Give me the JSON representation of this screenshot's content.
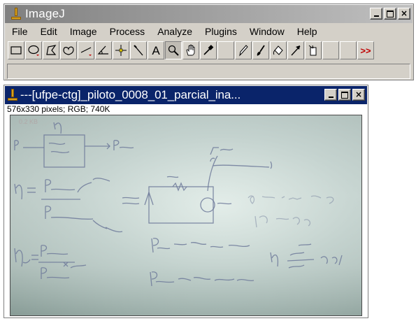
{
  "main_window": {
    "title": "ImageJ",
    "menu": [
      "File",
      "Edit",
      "Image",
      "Process",
      "Analyze",
      "Plugins",
      "Window",
      "Help"
    ],
    "tools": [
      {
        "name": "rectangle-tool",
        "icon": "rectangle-icon"
      },
      {
        "name": "oval-tool",
        "icon": "oval-icon"
      },
      {
        "name": "polygon-tool",
        "icon": "polygon-icon"
      },
      {
        "name": "freehand-tool",
        "icon": "freehand-icon"
      },
      {
        "name": "line-tool",
        "icon": "line-icon"
      },
      {
        "name": "angle-tool",
        "icon": "angle-icon"
      },
      {
        "name": "point-tool",
        "icon": "crosshair-icon"
      },
      {
        "name": "wand-tool",
        "icon": "wand-icon"
      },
      {
        "name": "text-tool",
        "icon": "text-icon",
        "glyph": "A"
      },
      {
        "name": "magnifier-tool",
        "icon": "magnifier-icon",
        "active": true
      },
      {
        "name": "scroll-tool",
        "icon": "hand-icon"
      },
      {
        "name": "dropper-tool",
        "icon": "dropper-icon"
      },
      {
        "name": "empty-slot-1",
        "icon": "blank"
      },
      {
        "name": "pencil-tool",
        "icon": "pencil-icon"
      },
      {
        "name": "brush-tool",
        "icon": "brush-icon"
      },
      {
        "name": "flood-fill-tool",
        "icon": "flood-fill-icon"
      },
      {
        "name": "arrow-tool",
        "icon": "arrow-icon"
      },
      {
        "name": "developer-menu-tool",
        "icon": "plugin-icon"
      },
      {
        "name": "empty-slot-2",
        "icon": "blank"
      },
      {
        "name": "empty-slot-3",
        "icon": "blank"
      },
      {
        "name": "more-tools",
        "icon": "double-chevron-icon",
        "glyph": ">>"
      }
    ]
  },
  "image_window": {
    "title": "---[ufpe-ctg]_piloto_0008_01_parcial_ina...",
    "info": "576x330 pixels; RGB; 740K"
  },
  "window_buttons": {
    "minimize": "_",
    "maximize": "□",
    "close": "×"
  },
  "colors": {
    "titlebar_active": "#0a246a",
    "titlebar_inactive": "#808080",
    "chrome": "#d4d0c8",
    "ink": "#6f7a9a"
  }
}
